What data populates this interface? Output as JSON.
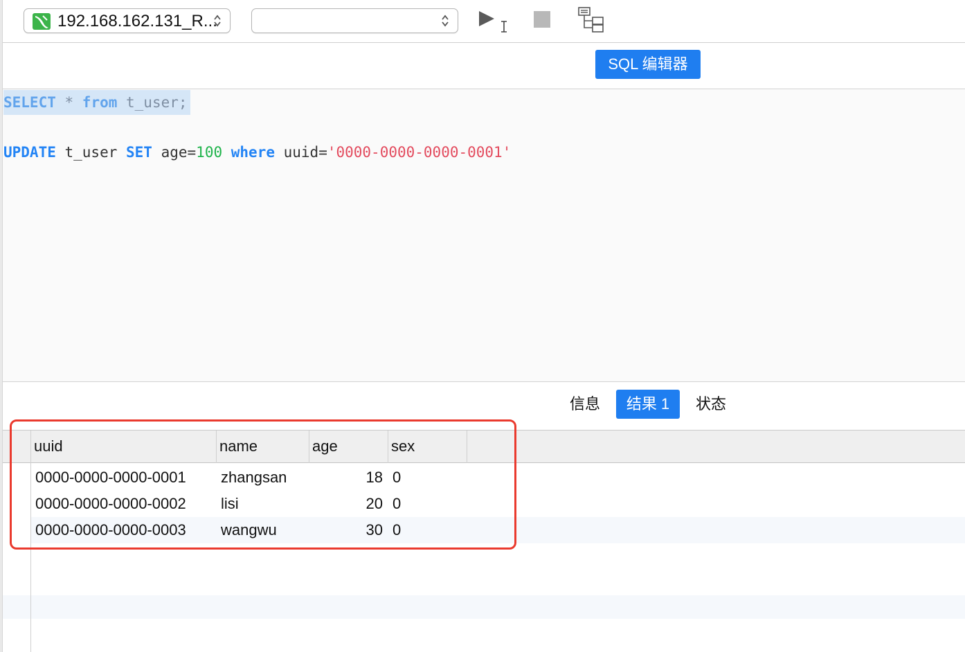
{
  "toolbar": {
    "connection_label": "192.168.162.131_R...",
    "database_value": "",
    "run_icon": "run-icon",
    "stop_icon": "stop-icon",
    "explain_icon": "explain-icon"
  },
  "editor_tabs": {
    "active_label": "SQL 编辑器"
  },
  "editor": {
    "line1": {
      "kw1": "SELECT",
      "t1": " * ",
      "kw2": "from",
      "t2": " t_user;"
    },
    "line2": {
      "kw1": "UPDATE",
      "t1": " t_user ",
      "kw2": "SET",
      "t2": " age=",
      "num": "100",
      "t3": " ",
      "kw3": "where",
      "t4": " uuid=",
      "str": "'0000-0000-0000-0001'"
    }
  },
  "result_tabs": {
    "info": "信息",
    "result": "结果 1",
    "status": "状态"
  },
  "grid": {
    "columns": [
      "uuid",
      "name",
      "age",
      "sex"
    ],
    "rows": [
      [
        "0000-0000-0000-0001",
        "zhangsan",
        "18",
        "0"
      ],
      [
        "0000-0000-0000-0002",
        "lisi",
        "20",
        "0"
      ],
      [
        "0000-0000-0000-0003",
        "wangwu",
        "30",
        "0"
      ]
    ]
  },
  "colors": {
    "accent": "#1f7ef0",
    "highlight": "#ea3a2e",
    "keyword": "#2384f5",
    "number": "#1eb34a",
    "string": "#e34b5e"
  }
}
